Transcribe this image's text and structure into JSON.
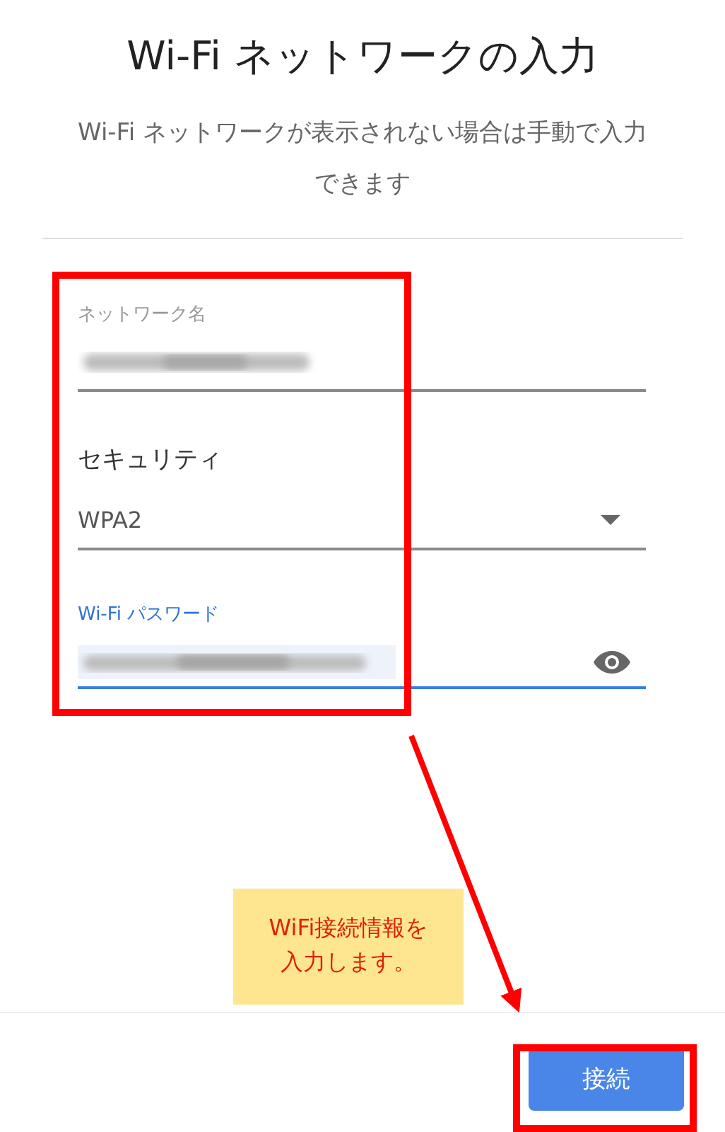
{
  "title": "Wi-Fi ネットワークの入力",
  "description": "Wi-Fi ネットワークが表示されない場合は手動で入力できます",
  "fields": [
    {
      "kind": "text",
      "label": "ネットワーク名",
      "focused": false
    },
    {
      "kind": "select",
      "label": "セキュリティ",
      "value": "WPA2",
      "focused": false
    },
    {
      "kind": "password",
      "label": "Wi-Fi パスワード",
      "focused": true
    }
  ],
  "annotation": {
    "note_lines": [
      "WiFi接続情報を",
      "入力します。"
    ]
  },
  "buttons": [
    {
      "label": "接続"
    }
  ]
}
